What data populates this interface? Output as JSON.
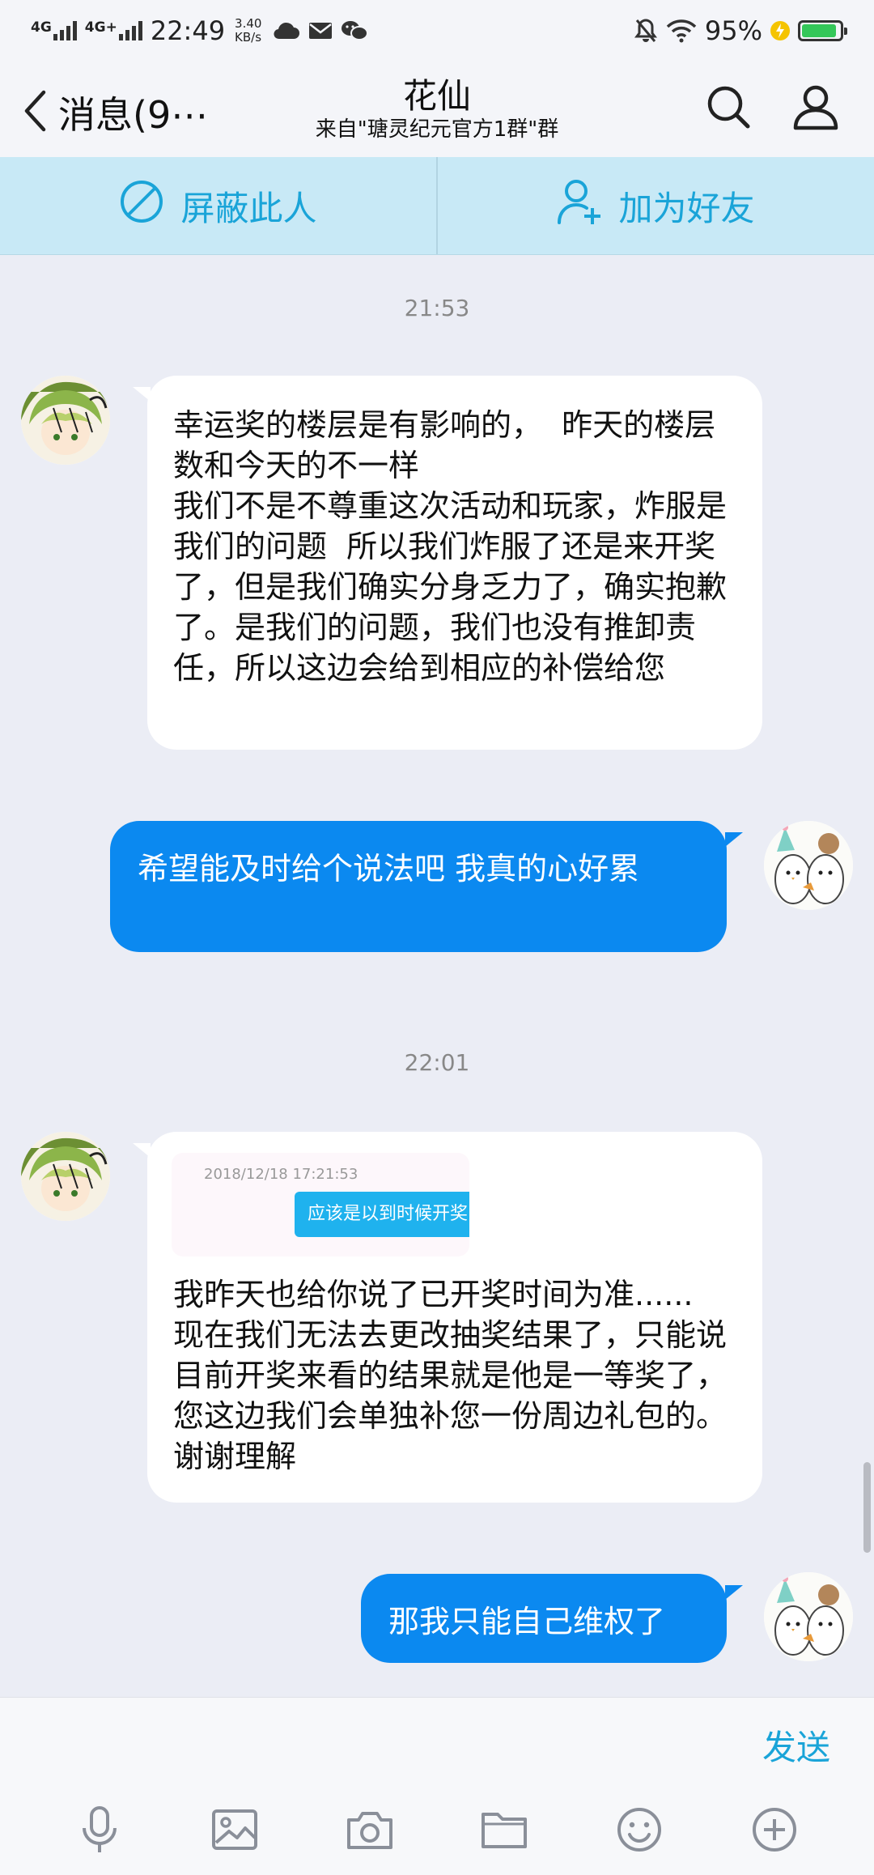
{
  "status_bar": {
    "network_1": "4G",
    "network_2": "4G+",
    "time": "22:49",
    "speed_value": "3.40",
    "speed_unit": "KB/s",
    "battery_percent": "95%",
    "battery_level": 0.95
  },
  "header": {
    "back_label": "消息(9⋯",
    "title": "花仙",
    "subtitle": "来自\"瑭灵纪元官方1群\"群"
  },
  "actions": {
    "block_label": "屏蔽此人",
    "add_friend_label": "加为好友"
  },
  "chat": {
    "timestamp_1": "21:53",
    "msg_1": "幸运奖的楼层是有影响的，  昨天的楼层数和今天的不一样\n我们不是不尊重这次活动和玩家，炸服是我们的问题  所以我们炸服了还是来开奖了，但是我们确实分身乏力了，确实抱歉了。是我们的问题，我们也没有推卸责任，所以这边会给到相应的补偿给您",
    "msg_2": "希望能及时给个说法吧 我真的心好累",
    "timestamp_2": "22:01",
    "quote_time": "2018/12/18 17:21:53",
    "quote_text": "应该是以到时候开奖",
    "msg_3": "我昨天也给你说了已开奖时间为准......  现在我们无法去更改抽奖结果了，只能说目前开奖来看的结果就是他是一等奖了，您这边我们会单独补您一份周边礼包的。 谢谢理解",
    "msg_4": "那我只能自己维权了"
  },
  "input": {
    "send_label": "发送"
  },
  "toolbar_icons": [
    "microphone-icon",
    "image-icon",
    "camera-icon",
    "folder-icon",
    "emoji-icon",
    "plus-icon"
  ],
  "colors": {
    "accent": "#1aa4d8",
    "outgoing_bubble": "#0b89f0",
    "action_bar": "#c8e9f6",
    "chat_background": "#ebedf5"
  }
}
